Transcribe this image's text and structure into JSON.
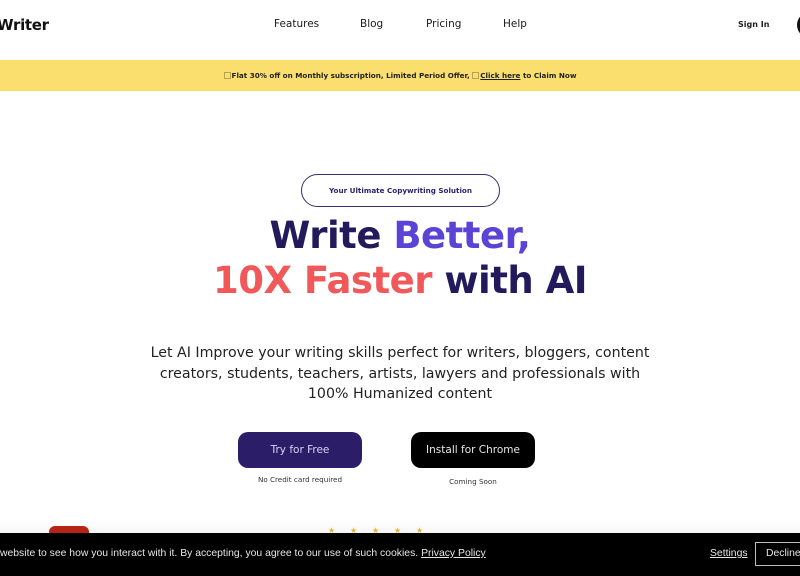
{
  "header": {
    "logo": "Writer",
    "nav": [
      {
        "label": "Features"
      },
      {
        "label": "Blog"
      },
      {
        "label": "Pricing"
      },
      {
        "label": "Help"
      }
    ],
    "sign_in": "Sign In"
  },
  "promo": {
    "text": "Flat 30% off on Monthly subscription, Limited Period Offer, ",
    "link": "Click here",
    "suffix": " to Claim Now"
  },
  "hero": {
    "badge": "Your Ultimate Copywriting Solution",
    "headline_line1_part1": "Write ",
    "headline_line1_part2": "Better,",
    "headline_line2_part1": "10X Faster",
    "headline_line2_part2": " with AI",
    "description": "Let AI Improve your writing skills perfect for writers, bloggers, content creators, students, teachers, artists, lawyers and professionals with 100% Humanized content",
    "primary_button": "Try for Free",
    "primary_caption": "No Credit card required",
    "secondary_button": "Install for Chrome",
    "secondary_caption": "Coming Soon"
  },
  "rating": {
    "stars": 5
  },
  "cookie_bar": {
    "text": "website to see how you interact with it. By accepting, you agree to our use of such cookies. ",
    "privacy_link": "Privacy Policy",
    "settings": "Settings",
    "decline": "Decline All"
  },
  "colors": {
    "brand_dark": "#231a5c",
    "accent_purple": "#5b43d6",
    "accent_red": "#f0585a",
    "promo_yellow": "#fbdf6e",
    "button_primary": "#2b1d68"
  },
  "icons": {
    "promo_glyph": "emoji-placeholder-icon",
    "star": "star-icon"
  }
}
